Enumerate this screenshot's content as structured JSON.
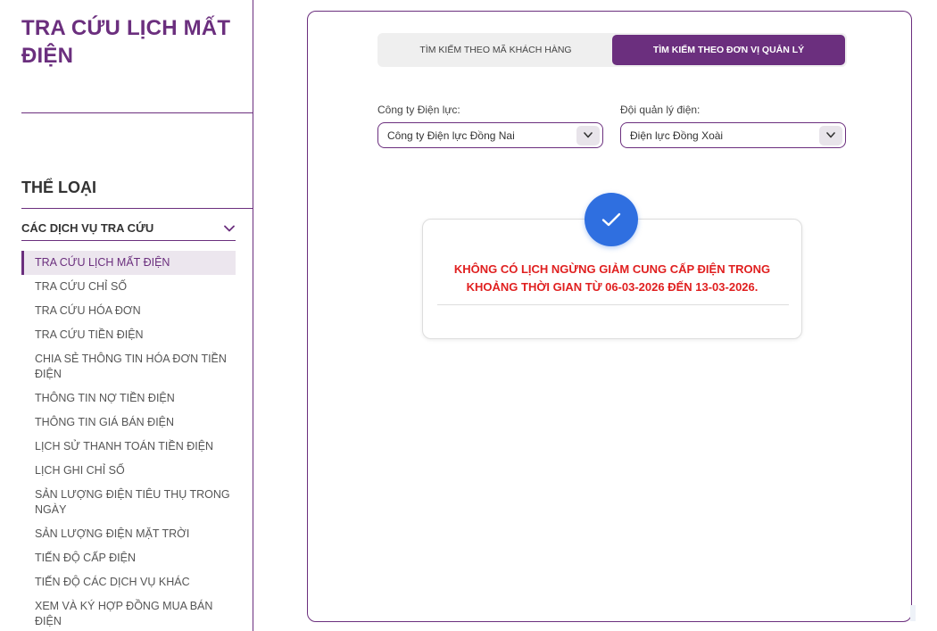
{
  "sidebar": {
    "page_title": "TRA CỨU LỊCH MẤT ĐIỆN",
    "category_heading": "THỂ LOẠI",
    "group_label": "CÁC DỊCH VỤ TRA CỨU",
    "items": [
      {
        "label": "TRA CỨU LỊCH MẤT ĐIỆN",
        "active": true
      },
      {
        "label": "TRA CỨU CHỈ SỐ"
      },
      {
        "label": "TRA CỨU HÓA ĐƠN"
      },
      {
        "label": "TRA CỨU TIỀN ĐIỆN"
      },
      {
        "label": "CHIA SẺ THÔNG TIN HÓA ĐƠN TIỀN ĐIỆN"
      },
      {
        "label": "THÔNG TIN NỢ TIỀN ĐIỆN"
      },
      {
        "label": "THÔNG TIN GIÁ BÁN ĐIỆN"
      },
      {
        "label": "LỊCH SỬ THANH TOÁN TIỀN ĐIỆN"
      },
      {
        "label": "LỊCH GHI CHỈ SỐ"
      },
      {
        "label": "SẢN LƯỢNG ĐIỆN TIÊU THỤ TRONG NGÀY"
      },
      {
        "label": "SẢN LƯỢNG ĐIỆN MẶT TRỜI"
      },
      {
        "label": "TIẾN ĐỘ CẤP ĐIỆN"
      },
      {
        "label": "TIẾN ĐỘ CÁC DỊCH VỤ KHÁC"
      },
      {
        "label": "XEM VÀ KÝ HỢP ĐỒNG MUA BÁN ĐIỆN"
      }
    ]
  },
  "main": {
    "tabs": [
      {
        "label": "TÌM KIẾM THEO MÃ KHÁCH HÀNG",
        "active": false
      },
      {
        "label": "TÌM KIẾM THEO ĐƠN VỊ QUẢN LÝ",
        "active": true
      }
    ],
    "company_field": {
      "label": "Công ty Điện lực:",
      "value": "Công ty Điện lực Đồng Nai"
    },
    "team_field": {
      "label": "Đội quản lý điện:",
      "value": "Điện lực Đồng Xoài"
    },
    "result": {
      "icon": "check-icon",
      "message": "KHÔNG CÓ LỊCH NGỪNG GIẢM CUNG CẤP ĐIỆN TRONG KHOẢNG THỜI GIAN TỪ 06-03-2026 ĐẾN 13-03-2026."
    }
  },
  "colors": {
    "brand": "#6b2f7e",
    "alert": "#e02020",
    "success_badge": "#2f6fe0"
  }
}
